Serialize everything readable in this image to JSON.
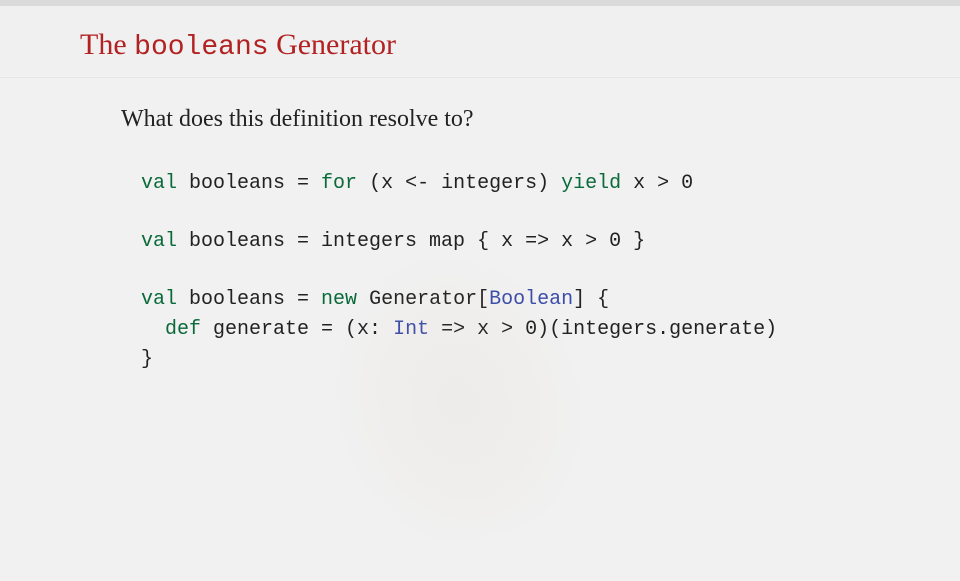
{
  "title": {
    "pre": "The ",
    "mono": "booleans",
    "post": " Generator"
  },
  "question": "What does this definition resolve to?",
  "code": {
    "line1": {
      "val": "val",
      "name": " booleans = ",
      "for": "for",
      "parens": " (x <- integers) ",
      "yield": "yield",
      "expr": " x > 0"
    },
    "line2": {
      "val": "val",
      "name": " booleans = integers map { x => x > 0 }"
    },
    "line3": {
      "val": "val",
      "name": " booleans = ",
      "new": "new",
      "gen": " Generator[",
      "type": "Boolean",
      "rest": "] {"
    },
    "line3b": {
      "indent": "  ",
      "def": "def",
      "name": " generate = (x: ",
      "type": "Int",
      "rest": " => x > 0)(integers.generate)"
    },
    "line3c": "}"
  }
}
